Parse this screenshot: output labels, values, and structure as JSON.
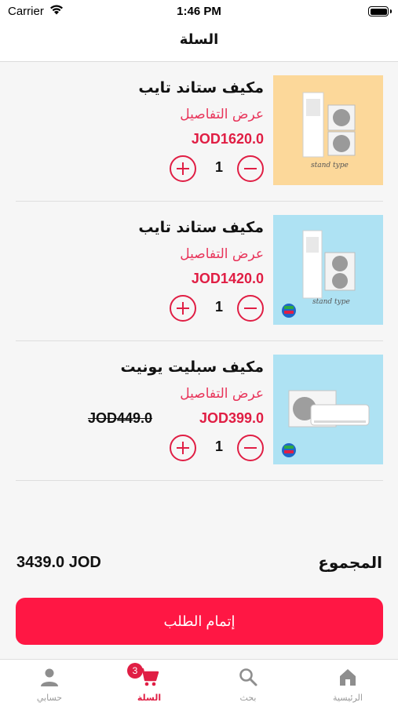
{
  "status_bar": {
    "carrier": "Carrier",
    "time": "1:46 PM"
  },
  "nav": {
    "title": "السلة"
  },
  "details_label": "عرض التفاصيل",
  "items": [
    {
      "name": "مكيف ستاند تايب",
      "price": "JOD1620.0",
      "old_price": "",
      "quantity": "1",
      "image_caption": "stand type",
      "image_bg": "#fcd89a"
    },
    {
      "name": "مكيف ستاند تايب",
      "price": "JOD1420.0",
      "old_price": "",
      "quantity": "1",
      "image_caption": "stand type",
      "image_bg": "#aee2f3"
    },
    {
      "name": "مكيف سبليت يونيت",
      "price": "JOD399.0",
      "old_price": "JOD449.0",
      "quantity": "1",
      "image_caption": "",
      "image_bg": "#aee2f3"
    }
  ],
  "summary": {
    "total_label": "المجموع",
    "total_value": "3439.0 JOD"
  },
  "checkout": {
    "label": "إتمام الطلب"
  },
  "tabs": [
    {
      "label": "حسابي",
      "icon": "person-icon",
      "active": false
    },
    {
      "label": "السلة",
      "icon": "cart-icon",
      "active": true
    },
    {
      "label": "بحث",
      "icon": "search-icon",
      "active": false
    },
    {
      "label": "الرئيسية",
      "icon": "home-icon",
      "active": false
    }
  ],
  "cart_badge": "3",
  "colors": {
    "accent": "#e01e44",
    "button": "#ff1744"
  }
}
